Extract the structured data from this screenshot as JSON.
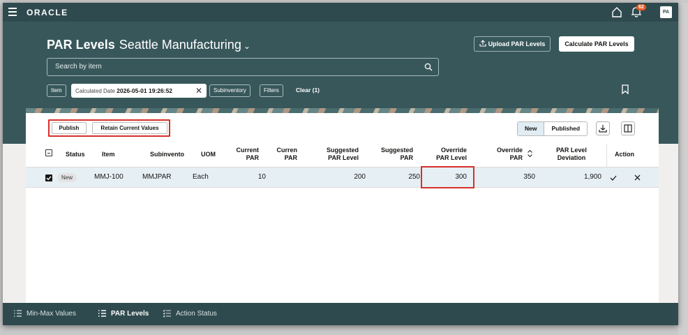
{
  "app": {
    "brand": "ORACLE",
    "notifications": "62",
    "avatar": "PA"
  },
  "header": {
    "title": "PAR Levels",
    "location": "Seattle Manufacturing",
    "upload_label": "Upload PAR Levels",
    "calculate_label": "Calculate PAR Levels"
  },
  "search": {
    "placeholder": "Search by item"
  },
  "filters": {
    "item": "Item",
    "date_label": "Calculated Date",
    "date_value": "2026-05-01 19:26:52",
    "subinventory": "Subinventory",
    "filters": "Filters",
    "clear": "Clear (1)"
  },
  "toolbar": {
    "publish": "Publish",
    "retain": "Retain Current Values",
    "seg_new": "New",
    "seg_published": "Published"
  },
  "columns": {
    "status": "Status",
    "item": "Item",
    "subinventory": "Subinvento",
    "uom": "UOM",
    "current_par_1": "Current",
    "current_par_2": "PAR",
    "current_1": "Curren",
    "current_2": "PAR",
    "suggested_level_1": "Suggested",
    "suggested_level_2": "PAR Level",
    "suggested_par_1": "Suggested",
    "suggested_par_2": "PAR",
    "override_level_1": "Override",
    "override_level_2": "PAR Level",
    "override_par_1": "Override",
    "override_par_2": "PAR",
    "deviation_1": "PAR Level",
    "deviation_2": "Deviation",
    "action": "Action"
  },
  "rows": [
    {
      "status": "New",
      "item": "MMJ-100",
      "subinventory": "MMJPAR",
      "uom": "Each",
      "current_par": "10",
      "current": "",
      "suggested_level": "200",
      "suggested_par": "250",
      "override_level": "300",
      "override_par": "350",
      "deviation": "1,900"
    }
  ],
  "tabs": [
    {
      "label": "Min-Max Values"
    },
    {
      "label": "PAR Levels"
    },
    {
      "label": "Action Status"
    }
  ]
}
